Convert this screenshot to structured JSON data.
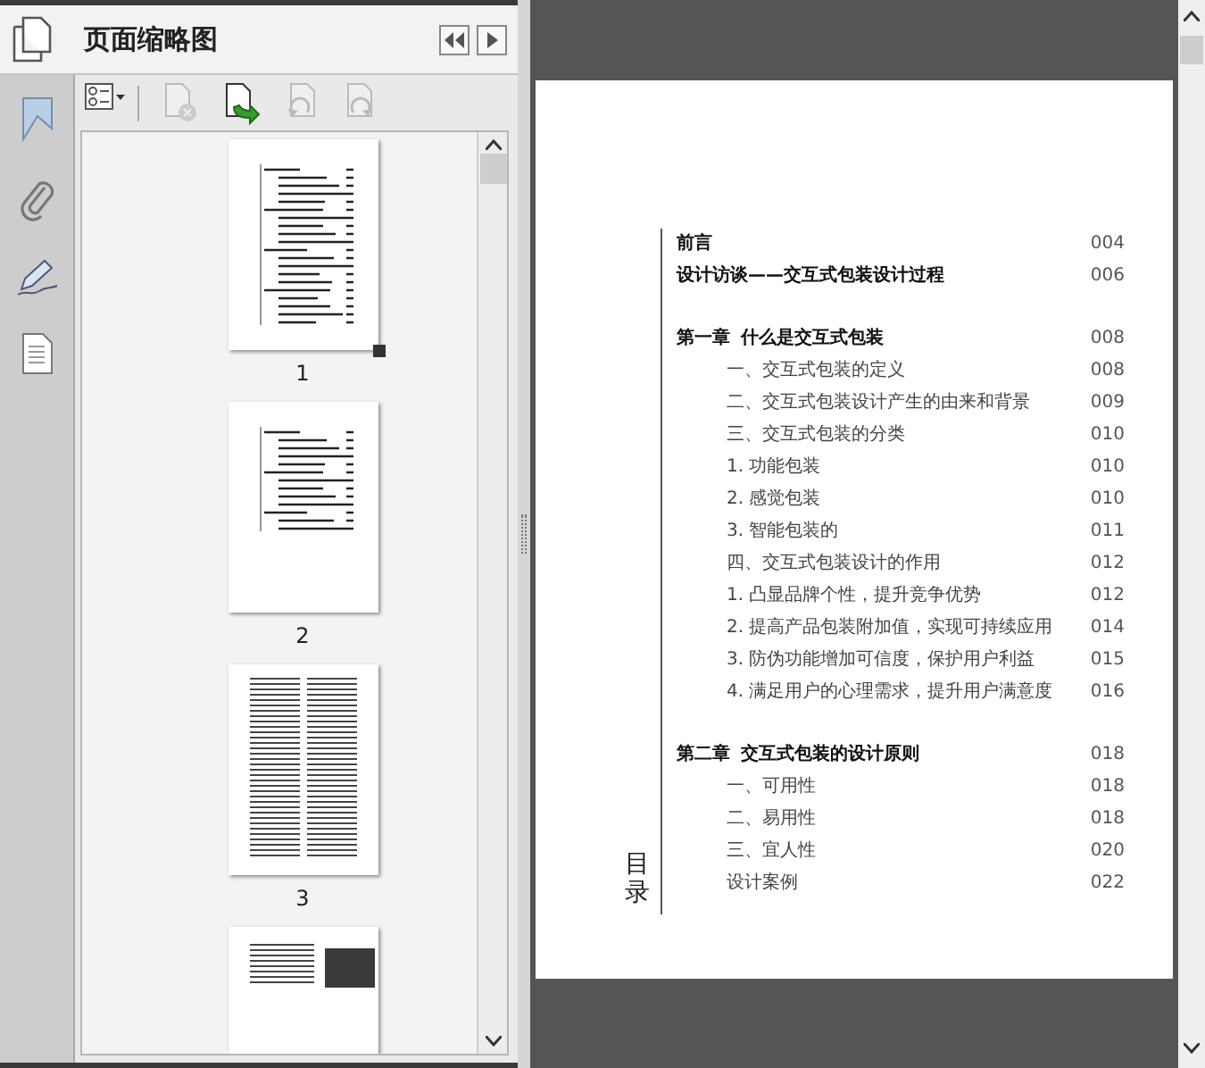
{
  "panel": {
    "title": "页面缩略图"
  },
  "tools": [
    {
      "kind": "options",
      "disabled": false
    },
    {
      "kind": "delete",
      "disabled": true
    },
    {
      "kind": "insert",
      "disabled": false
    },
    {
      "kind": "rotate-left",
      "disabled": true
    },
    {
      "kind": "rotate-right",
      "disabled": true
    }
  ],
  "thumbnails": [
    {
      "label": "1",
      "kind": "toc",
      "selected": true
    },
    {
      "label": "2",
      "kind": "list",
      "selected": false
    },
    {
      "label": "3",
      "kind": "text",
      "selected": false
    },
    {
      "kind": "photo",
      "selected": false
    }
  ],
  "document": {
    "toc_title": "目录",
    "groups": [
      {
        "entries": [
          {
            "kind": "heading",
            "title": "前言",
            "page": "004"
          },
          {
            "kind": "heading",
            "title": "设计访谈——交互式包装设计过程",
            "page": "006"
          }
        ]
      },
      {
        "entries": [
          {
            "kind": "chapter",
            "label": "第一章",
            "title": "什么是交互式包装",
            "page": "008"
          },
          {
            "kind": "item",
            "title": "一、交互式包装的定义",
            "page": "008"
          },
          {
            "kind": "item",
            "title": "二、交互式包装设计产生的由来和背景",
            "page": "009"
          },
          {
            "kind": "item",
            "title": "三、交互式包装的分类",
            "page": "010"
          },
          {
            "kind": "item",
            "title": "1. 功能包装",
            "page": "010"
          },
          {
            "kind": "item",
            "title": "2. 感觉包装",
            "page": "010"
          },
          {
            "kind": "item",
            "title": "3. 智能包装的",
            "page": "011"
          },
          {
            "kind": "item",
            "title": "四、交互式包装设计的作用",
            "page": "012"
          },
          {
            "kind": "item",
            "title": "1. 凸显品牌个性，提升竞争优势",
            "page": "012"
          },
          {
            "kind": "item",
            "title": "2. 提高产品包装附加值，实现可持续应用",
            "page": "014"
          },
          {
            "kind": "item",
            "title": "3. 防伪功能增加可信度，保护用户利益",
            "page": "015"
          },
          {
            "kind": "item",
            "title": "4. 满足用户的心理需求，提升用户满意度",
            "page": "016"
          }
        ]
      },
      {
        "entries": [
          {
            "kind": "chapter",
            "label": "第二章",
            "title": "交互式包装的设计原则",
            "page": "018"
          },
          {
            "kind": "item",
            "title": "一、可用性",
            "page": "018"
          },
          {
            "kind": "item",
            "title": "二、易用性",
            "page": "018"
          },
          {
            "kind": "item",
            "title": "三、宜人性",
            "page": "020"
          },
          {
            "kind": "item",
            "title": "设计案例",
            "page": "022"
          }
        ]
      }
    ]
  }
}
